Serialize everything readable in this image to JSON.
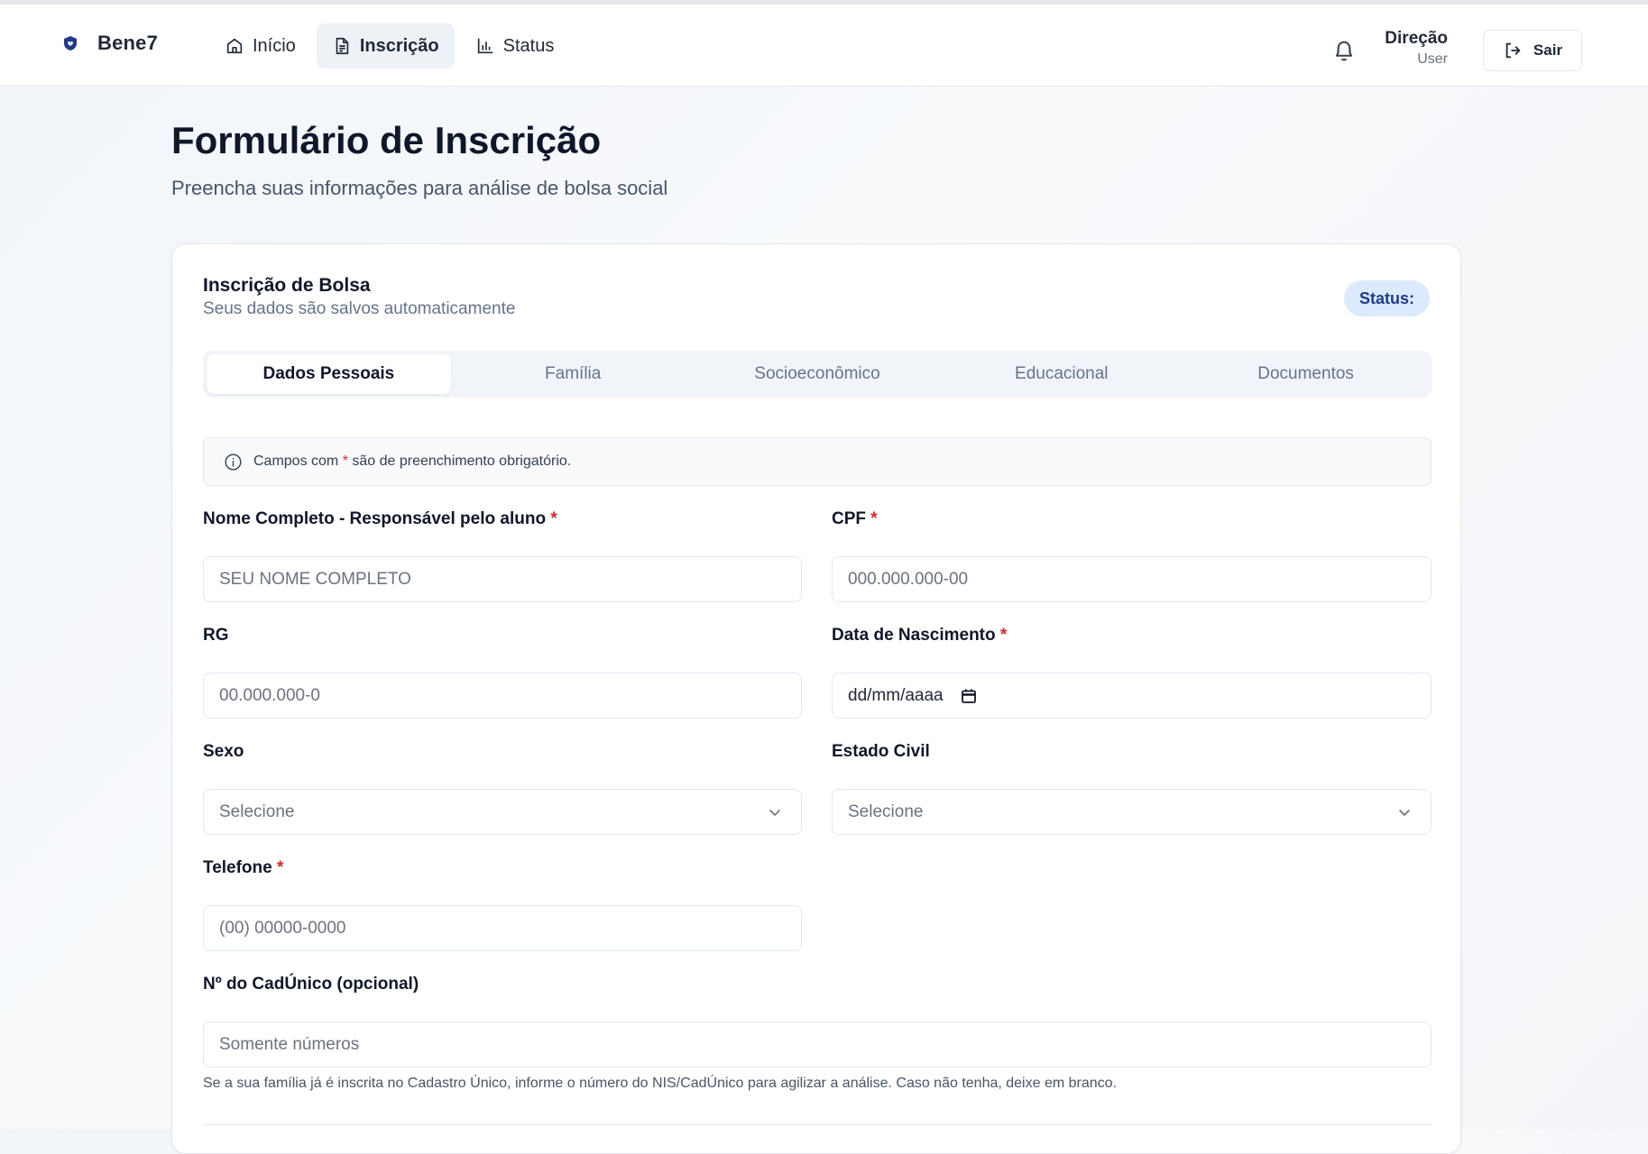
{
  "header": {
    "brand": "Bene7",
    "nav": [
      {
        "label": "Início",
        "icon": "home-icon"
      },
      {
        "label": "Inscrição",
        "icon": "document-icon",
        "active": true
      },
      {
        "label": "Status",
        "icon": "bar-chart-icon"
      }
    ],
    "user_name": "Direção",
    "user_role": "User",
    "logout_label": "Sair"
  },
  "page": {
    "title": "Formulário de Inscrição",
    "subtitle": "Preencha suas informações para análise de bolsa social"
  },
  "card": {
    "title": "Inscrição de Bolsa",
    "subtitle": "Seus dados são salvos automaticamente",
    "status_label": "Status:"
  },
  "tabs": [
    "Dados Pessoais",
    "Família",
    "Socioeconômico",
    "Educacional",
    "Documentos"
  ],
  "info": {
    "prefix": "Campos com",
    "asterisk": "*",
    "suffix": "são de preenchimento obrigatório."
  },
  "fields": {
    "nome": {
      "label": "Nome Completo - Responsável pelo aluno",
      "placeholder": "SEU NOME COMPLETO",
      "required": "*"
    },
    "cpf": {
      "label": "CPF",
      "placeholder": "000.000.000-00",
      "required": "*"
    },
    "rg": {
      "label": "RG",
      "placeholder": "00.000.000-0"
    },
    "nascimento": {
      "label": "Data de Nascimento",
      "placeholder": "dd/mm/aaaa",
      "required": "*"
    },
    "sexo": {
      "label": "Sexo",
      "value": "Selecione"
    },
    "estado_civil": {
      "label": "Estado Civil",
      "value": "Selecione"
    },
    "telefone": {
      "label": "Telefone",
      "placeholder": "(00) 00000-0000",
      "required": "*"
    },
    "cadunico": {
      "label": "Nº do CadÚnico (opcional)",
      "placeholder": "Somente números",
      "helper": "Se a sua família já é inscrita no Cadastro Único, informe o número do NIS/CadÚnico para agilizar a análise. Caso não tenha, deixe em branco."
    }
  },
  "colors": {
    "accent": "#1e3a8a",
    "required": "#dc2626",
    "badge_bg": "#dbeafe"
  }
}
